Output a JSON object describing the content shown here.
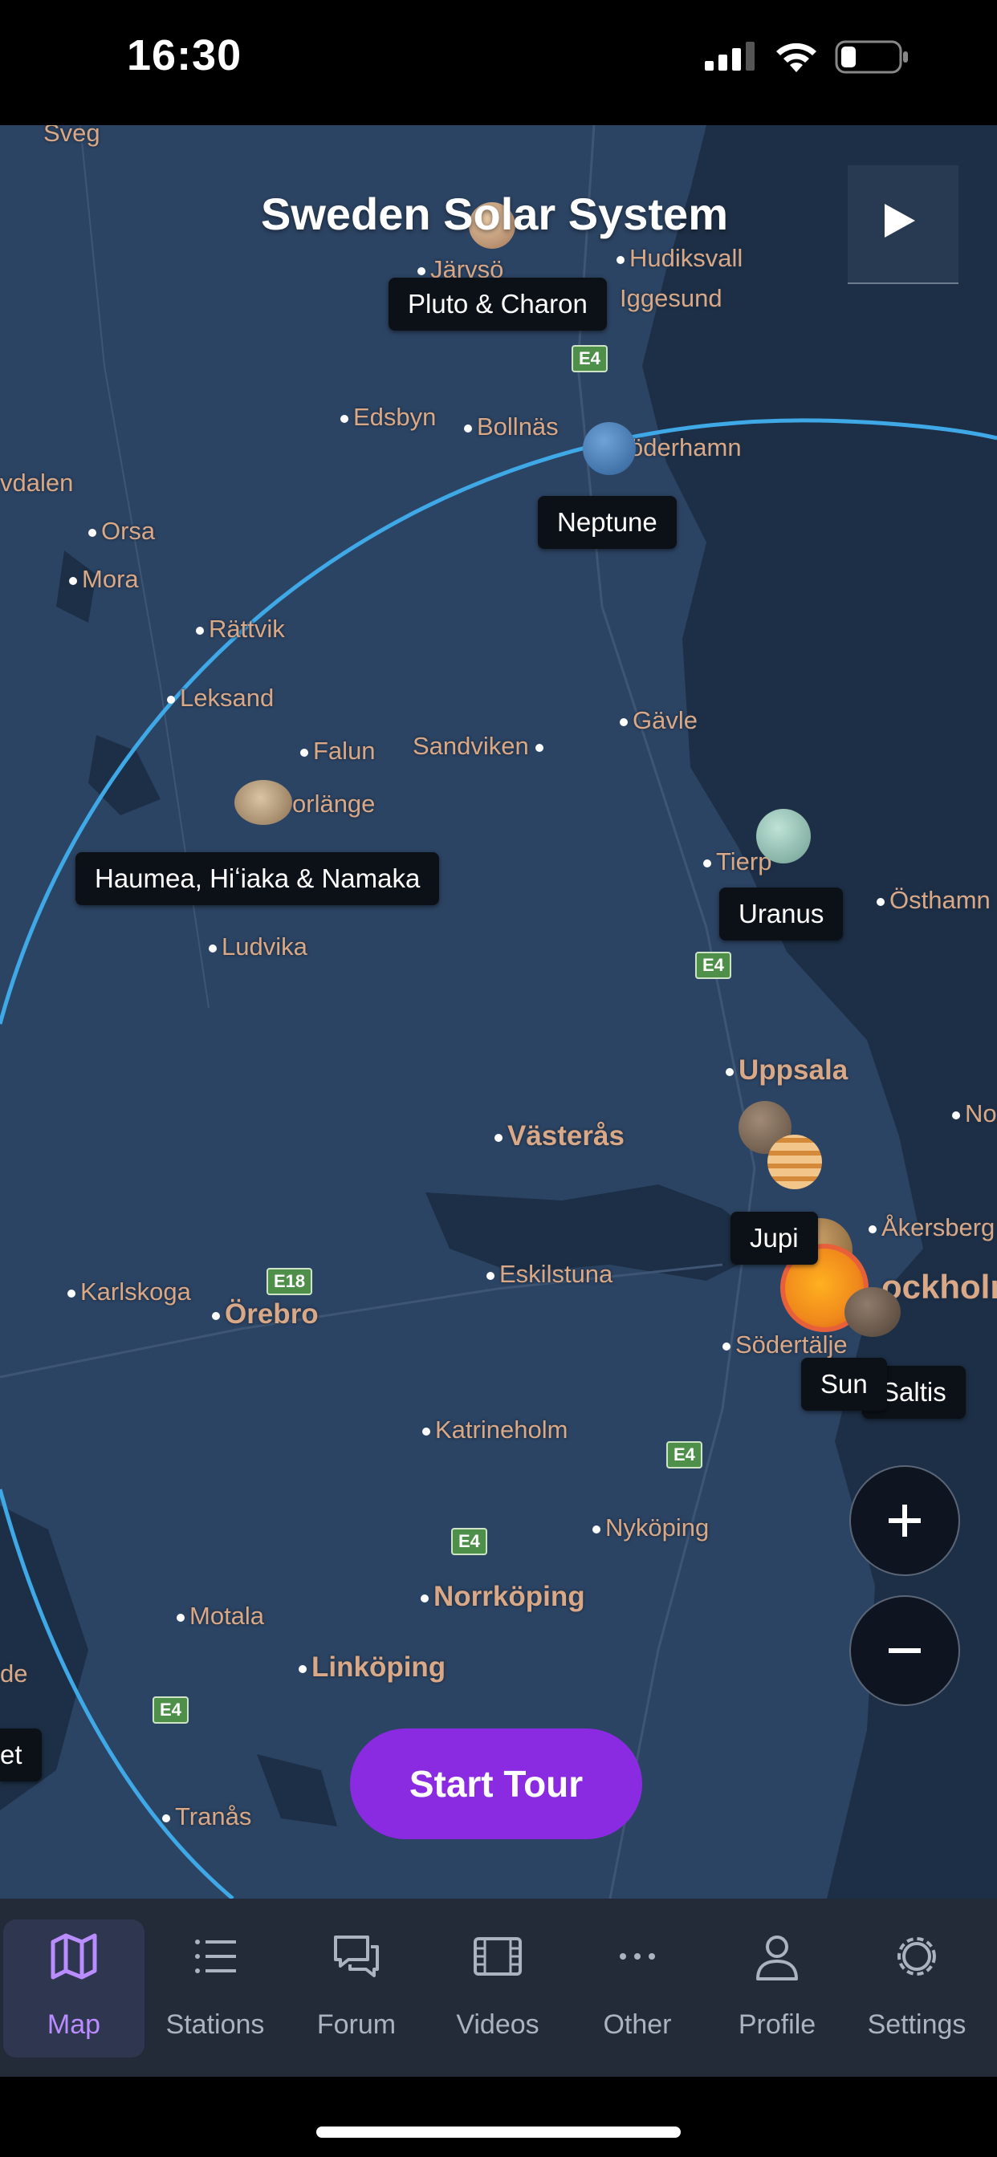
{
  "status": {
    "time": "16:30"
  },
  "map": {
    "title": "Sweden Solar System",
    "places": {
      "sveg": "Sveg",
      "jarvso": "Järvsö",
      "hudiksvall": "Hudiksvall",
      "iggesund": "Iggesund",
      "edsbyn": "Edsbyn",
      "bollnas": "Bollnäs",
      "soderhamn": "öderhamn",
      "vdalen": "vdalen",
      "orsa": "Orsa",
      "mora": "Mora",
      "rattvik": "Rättvik",
      "leksand": "Leksand",
      "falun": "Falun",
      "sandviken": "Sandviken",
      "gavle": "Gävle",
      "borlange": "orlänge",
      "tierp": "Tierp",
      "osthammar": "Östhamn",
      "ludvika": "Ludvika",
      "uppsala": "Uppsala",
      "norr": "No",
      "vasteras": "Västerås",
      "akersberga": "Åkersberg",
      "karlskoga": "Karlskoga",
      "orebro": "Örebro",
      "eskilstuna": "Eskilstuna",
      "stockholm": "ockholm",
      "sodertalje": "Södertälje",
      "katrineholm": "Katrineholm",
      "nykoping": "Nyköping",
      "motala": "Motala",
      "norrkoping": "Norrköping",
      "linkoping": "Linköping",
      "de": "de",
      "tranas": "Tranås"
    },
    "roads": {
      "e4_1": "E4",
      "e4_2": "E4",
      "e18": "E18",
      "e4_3": "E4",
      "e4_4": "E4",
      "e4_5": "E4"
    },
    "labels": {
      "pluto": "Pluto & Charon",
      "neptune": "Neptune",
      "haumea": "Haumea, Hiʻiaka & Namaka",
      "uranus": "Uranus",
      "jupiter": "Jupi",
      "sun": "Sun",
      "saltis": "Saltis",
      "edge": "et"
    },
    "colors": {
      "orbit": "#3fa9e8",
      "sun": "#f08a1c",
      "accent": "#8a2be2"
    }
  },
  "controls": {
    "zoom_in": "+",
    "zoom_out": "−",
    "play_icon": "play-icon",
    "start_tour": "Start Tour"
  },
  "tabs": [
    {
      "label": "Map",
      "icon": "map-icon",
      "active": true
    },
    {
      "label": "Stations",
      "icon": "list-icon"
    },
    {
      "label": "Forum",
      "icon": "chat-icon"
    },
    {
      "label": "Videos",
      "icon": "film-icon"
    },
    {
      "label": "Other",
      "icon": "more-icon"
    },
    {
      "label": "Profile",
      "icon": "person-icon"
    },
    {
      "label": "Settings",
      "icon": "gear-icon"
    }
  ]
}
